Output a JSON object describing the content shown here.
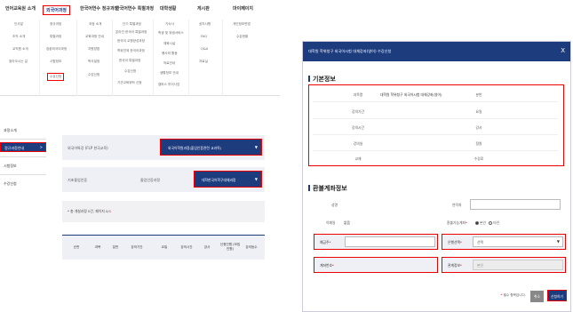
{
  "site": {
    "gnb": [
      {
        "title": "언어교육원 소개",
        "items": [
          "인사말",
          "조직 소개",
          "교직원 소개",
          "찾아오시는 길"
        ]
      },
      {
        "title": "외국어과정",
        "items": [
          "정규과정",
          "특별과정",
          "집중외국어과정",
          "시험정보",
          "수강신청"
        ]
      },
      {
        "title": "한국어연수 정규과정",
        "items": [
          "과정 소개",
          "교육과정 안내",
          "지원방법",
          "학사일정",
          "수업신청"
        ]
      },
      {
        "title": "한국어연수 특별과정",
        "items": [
          "단기 특별과정",
          "온라인 한국어 특별과정",
          "한국어 교원양성과정",
          "학위연계 한국어과정",
          "한국어 특별과정",
          "수강신청",
          "기관교육위탁 신청"
        ]
      },
      {
        "title": "대학생활",
        "items": [
          "기숙사",
          "학생 및 위생서비스",
          "체육시설",
          "행사와 활동",
          "의료안내",
          "생활정보 안내",
          "캠퍼스 투어사업"
        ]
      },
      {
        "title": "게시판",
        "items": [
          "공지사항",
          "FAQ",
          "Q&A",
          "자료실"
        ]
      },
      {
        "title": "마이페이지",
        "items": [
          "개인정보변경",
          "수강현황"
        ]
      }
    ],
    "side": [
      "과정소개",
      "정규과정안내",
      "시험정보",
      "수강신청"
    ],
    "sel1_label": "외국어특강 (FLP 한국교육)",
    "sel1_value": "외국어학원과정(졸업인증관련 교과목)",
    "sel2_label": "기초졸업인증",
    "sel2_label2": "졸업인증과정",
    "sel2_value": "대학한국어학구대체과정",
    "info_prefix": "*",
    "info_text": " 총 개설과정 0건, 페이지 0/",
    "info_red": "1",
    "table_headers": [
      "순번",
      "과목",
      "분반",
      "강의기간",
      "요일",
      "강의시간",
      "강사",
      "신청인원 (모집인원)",
      "강의등수"
    ]
  },
  "modal": {
    "title": "대학원 학위청구 외국어시험 대체강좌(영어) 수강신청",
    "close": "X",
    "basic_title": "기본정보",
    "basic": [
      {
        "label": "과목명",
        "value": "대학원 학위청구 외국어시험 대체강좌(영어)",
        "label2": "분반",
        "value2": ""
      },
      {
        "label": "강의기간",
        "value": "",
        "label2": "요일",
        "value2": ""
      },
      {
        "label": "강의시간",
        "value": "",
        "label2": "강사",
        "value2": ""
      },
      {
        "label": "강의실",
        "value": "",
        "label2": "정원",
        "value2": ""
      },
      {
        "label": "교재",
        "value": "",
        "label2": "수강료",
        "value2": ""
      }
    ],
    "refund_title": "환불계좌정보",
    "name_label": "성명",
    "phone_label": "연락처",
    "email_label": "이메일",
    "email_value": "없음",
    "refund_ok_label": "환불가능계좌",
    "refund_ok_req": "*",
    "radio1": "본인",
    "radio2": "타인",
    "holder_label": "예금주",
    "bank_label": "은행선택",
    "bank_value": "선택",
    "account_label": "계좌번호",
    "relation_label": "관계정보",
    "relation_value": "본인",
    "req_mark": "*",
    "foot_note_mark": "*",
    "foot_note": " 필수 항목입니다.",
    "btn_cancel": "취소",
    "btn_apply": "신청하기"
  }
}
